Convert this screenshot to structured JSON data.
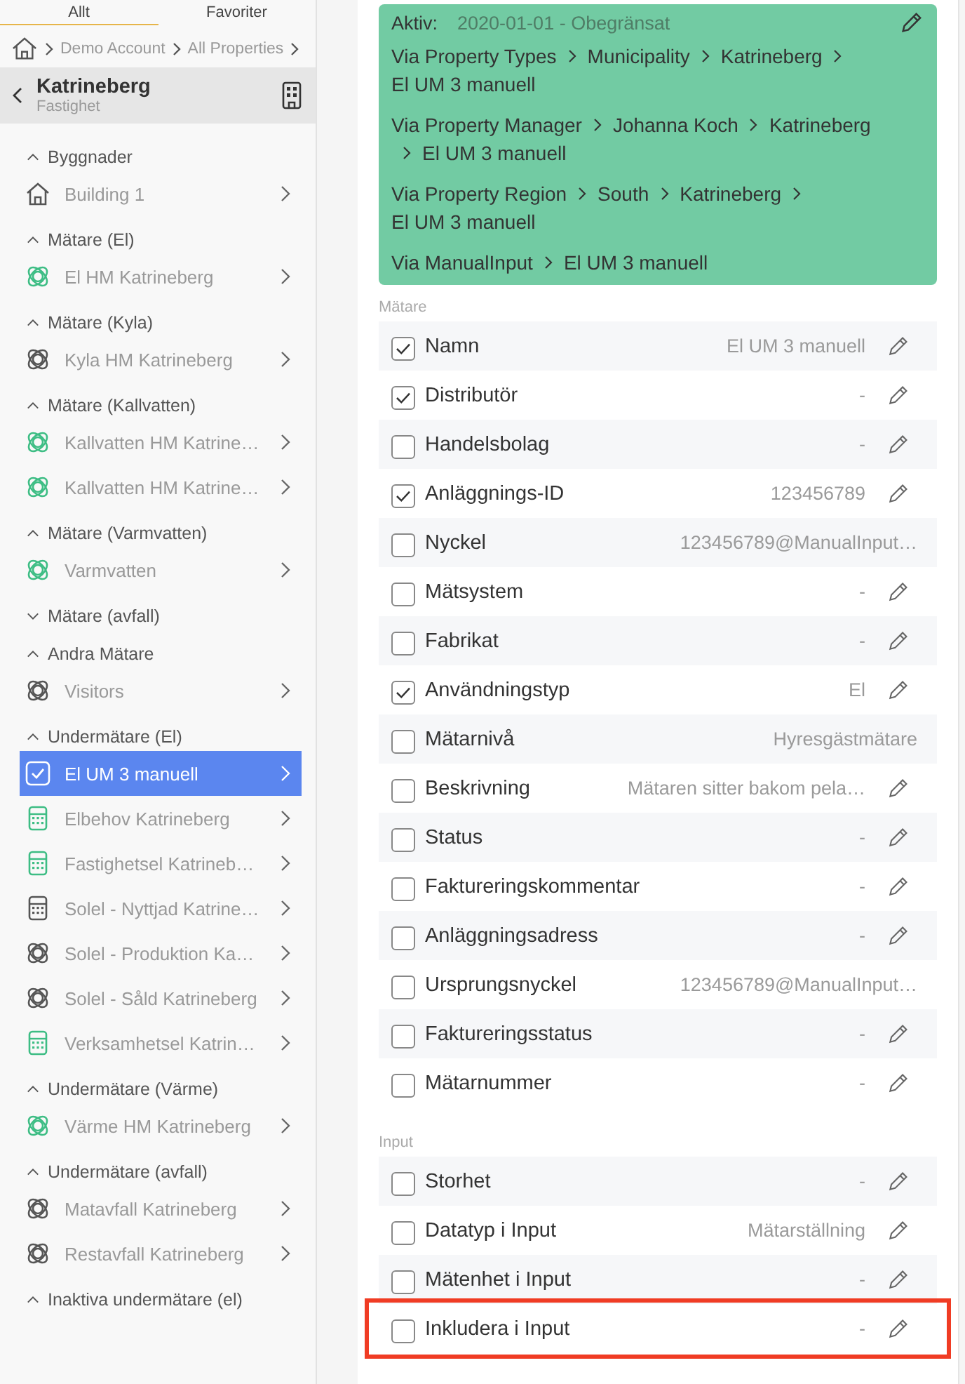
{
  "tabs": [
    {
      "label": "Allt",
      "selected": true
    },
    {
      "label": "Favoriter",
      "selected": false
    }
  ],
  "breadcrumb": [
    "Demo Account",
    "All Properties"
  ],
  "property": {
    "name": "Katrineberg",
    "type": "Fastighet"
  },
  "groups": [
    {
      "title": "Byggnader",
      "expanded": true,
      "items": [
        {
          "label": "Building 1",
          "kind": "building",
          "color": "#555555",
          "selected": false
        }
      ]
    },
    {
      "title": "Mätare (El)",
      "expanded": true,
      "items": [
        {
          "label": "El HM Katrineberg",
          "kind": "meter",
          "color": "#3dbd84",
          "selected": false
        }
      ]
    },
    {
      "title": "Mätare (Kyla)",
      "expanded": true,
      "items": [
        {
          "label": "Kyla HM Katrineberg",
          "kind": "meter",
          "color": "#555555",
          "selected": false
        }
      ]
    },
    {
      "title": "Mätare (Kallvatten)",
      "expanded": true,
      "items": [
        {
          "label": "Kallvatten HM Katrine…",
          "kind": "meter",
          "color": "#3dbd84",
          "selected": false
        },
        {
          "label": "Kallvatten HM Katrine…",
          "kind": "meter",
          "color": "#3dbd84",
          "selected": false
        }
      ]
    },
    {
      "title": "Mätare (Varmvatten)",
      "expanded": true,
      "items": [
        {
          "label": "Varmvatten",
          "kind": "meter",
          "color": "#3dbd84",
          "selected": false
        }
      ]
    },
    {
      "title": "Mätare (avfall)",
      "expanded": false
    },
    {
      "title": "Andra Mätare",
      "expanded": true,
      "items": [
        {
          "label": "Visitors",
          "kind": "meter",
          "color": "#555555",
          "selected": false
        }
      ]
    },
    {
      "title": "Undermätare (El)",
      "expanded": true,
      "items": [
        {
          "label": "El UM 3 manuell",
          "selected": true
        },
        {
          "label": "Elbehov Katrineberg",
          "kind": "calculator",
          "color": "#3dbd84",
          "selected": false
        },
        {
          "label": "Fastighetsel Katrineb…",
          "kind": "calculator",
          "color": "#3dbd84",
          "selected": false
        },
        {
          "label": "Solel - Nyttjad Katrine…",
          "kind": "calculator",
          "color": "#555555",
          "selected": false
        },
        {
          "label": "Solel - Produktion Ka…",
          "kind": "meter",
          "color": "#555555",
          "selected": false
        },
        {
          "label": "Solel - Såld Katrineberg",
          "kind": "meter",
          "color": "#555555",
          "selected": false
        },
        {
          "label": "Verksamhetsel Katrin…",
          "kind": "calculator",
          "color": "#3dbd84",
          "selected": false
        }
      ]
    },
    {
      "title": "Undermätare (Värme)",
      "expanded": true,
      "items": [
        {
          "label": "Värme HM Katrineberg",
          "kind": "meter",
          "color": "#3dbd84",
          "selected": false
        }
      ]
    },
    {
      "title": "Undermätare (avfall)",
      "expanded": true,
      "items": [
        {
          "label": "Matavfall Katrineberg",
          "kind": "meter",
          "color": "#555555",
          "selected": false
        },
        {
          "label": "Restavfall Katrineberg",
          "kind": "meter",
          "color": "#555555",
          "selected": false
        }
      ]
    },
    {
      "title": "Inaktiva undermätare (el)",
      "expanded": true
    }
  ],
  "active": {
    "label": "Aktiv:",
    "period": "2020-01-01 - Obegränsat",
    "paths": [
      [
        "Via Property Types",
        "Municipality",
        "Katrineberg",
        "El UM 3 manuell"
      ],
      [
        "Via Property Manager",
        "Johanna Koch",
        "Katrineberg",
        "El UM 3 manuell"
      ],
      [
        "Via Property Region",
        "South",
        "Katrineberg",
        "El UM 3 manuell"
      ],
      [
        "Via ManualInput",
        "El UM 3 manuell"
      ]
    ]
  },
  "sections": [
    {
      "title": "Mätare",
      "rows": [
        {
          "label": "Namn",
          "value": "El UM 3 manuell",
          "checked": true,
          "editable": true,
          "highlighted": false
        },
        {
          "label": "Distributör",
          "value": "-",
          "checked": true,
          "editable": true,
          "highlighted": false
        },
        {
          "label": "Handelsbolag",
          "value": "-",
          "checked": false,
          "editable": true,
          "highlighted": false
        },
        {
          "label": "Anläggnings-ID",
          "value": "123456789",
          "checked": true,
          "editable": true,
          "highlighted": false
        },
        {
          "label": "Nyckel",
          "value": "123456789@ManualInput…",
          "checked": false,
          "editable": false,
          "highlighted": false
        },
        {
          "label": "Mätsystem",
          "value": "-",
          "checked": false,
          "editable": true,
          "highlighted": false
        },
        {
          "label": "Fabrikat",
          "value": "-",
          "checked": false,
          "editable": true,
          "highlighted": false
        },
        {
          "label": "Användningstyp",
          "value": "El",
          "checked": true,
          "editable": true,
          "highlighted": false
        },
        {
          "label": "Mätarnivå",
          "value": "Hyresgästmätare",
          "checked": false,
          "editable": false,
          "highlighted": false
        },
        {
          "label": "Beskrivning",
          "value": "Mätaren sitter bakom pela…",
          "checked": false,
          "editable": true,
          "highlighted": false
        },
        {
          "label": "Status",
          "value": "-",
          "checked": false,
          "editable": true,
          "highlighted": false
        },
        {
          "label": "Faktureringskommentar",
          "value": "-",
          "checked": false,
          "editable": true,
          "highlighted": false
        },
        {
          "label": "Anläggningsadress",
          "value": "-",
          "checked": false,
          "editable": true,
          "highlighted": false
        },
        {
          "label": "Ursprungsnyckel",
          "value": "123456789@ManualInput…",
          "checked": false,
          "editable": false,
          "highlighted": false
        },
        {
          "label": "Faktureringsstatus",
          "value": "-",
          "checked": false,
          "editable": true,
          "highlighted": false
        },
        {
          "label": "Mätarnummer",
          "value": "-",
          "checked": false,
          "editable": true,
          "highlighted": false
        }
      ]
    },
    {
      "title": "Input",
      "rows": [
        {
          "label": "Storhet",
          "value": "-",
          "checked": false,
          "editable": true,
          "highlighted": false
        },
        {
          "label": "Datatyp i Input",
          "value": "Mätarställning",
          "checked": false,
          "editable": true,
          "highlighted": false
        },
        {
          "label": "Mätenhet i Input",
          "value": "-",
          "checked": false,
          "editable": true,
          "highlighted": false
        },
        {
          "label": "Inkludera i Input",
          "value": "-",
          "checked": false,
          "editable": true,
          "highlighted": true
        }
      ]
    }
  ]
}
